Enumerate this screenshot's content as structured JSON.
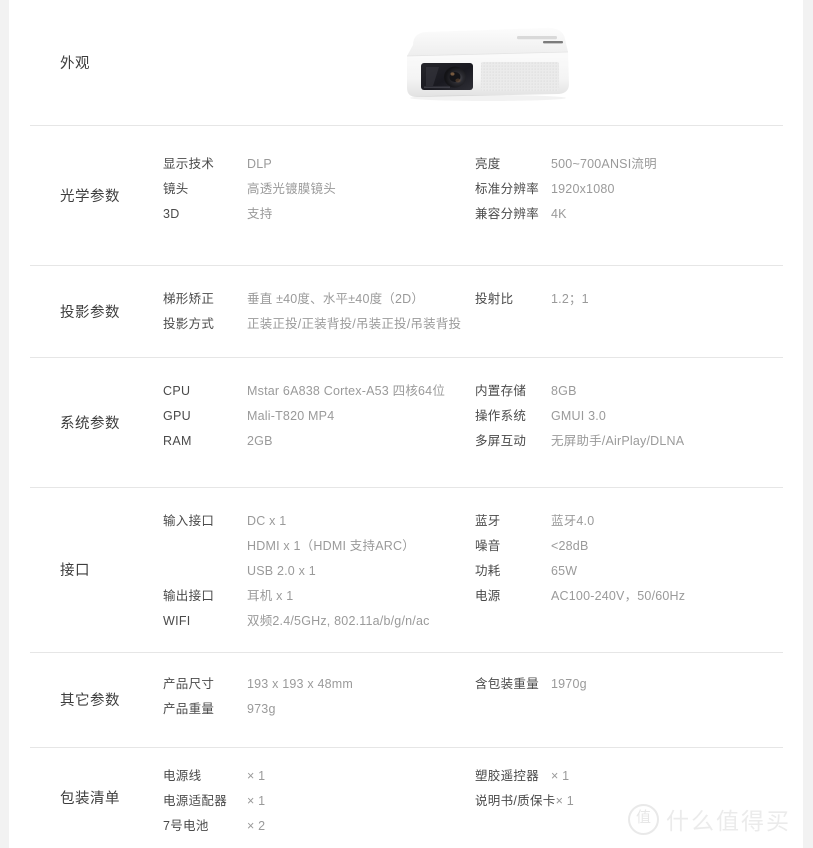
{
  "page": {
    "background": "#ffffff",
    "gutter_color": "#f2f2f2",
    "divider_color": "#e6e6e6",
    "title_color": "#3d3d3d",
    "key_color": "#4a4a4a",
    "value_color": "#9a9a9a"
  },
  "appearance": {
    "title": "外观",
    "image_alt": "白色投影仪正面图"
  },
  "sections": [
    {
      "id": "optics",
      "title": "光学参数",
      "left": [
        {
          "key": "显示技术",
          "value": "DLP"
        },
        {
          "key": "镜头",
          "value": "高透光镀膜镜头"
        },
        {
          "key": "3D",
          "value": "支持"
        }
      ],
      "right": [
        {
          "key": "亮度",
          "value": "500~700ANSI流明"
        },
        {
          "key": "标准分辨率",
          "value": "1920x1080"
        },
        {
          "key": "兼容分辨率",
          "value": "4K"
        }
      ]
    },
    {
      "id": "projection",
      "title": "投影参数",
      "left": [
        {
          "key": "梯形矫正",
          "value": "垂直 ±40度、水平±40度（2D）"
        },
        {
          "key": "投影方式",
          "value": "正装正投/正装背投/吊装正投/吊装背投"
        }
      ],
      "right": [
        {
          "key": "投射比",
          "value": "1.2；1"
        }
      ]
    },
    {
      "id": "system",
      "title": "系统参数",
      "left": [
        {
          "key": "CPU",
          "value": "Mstar 6A838 Cortex-A53 四核64位"
        },
        {
          "key": "GPU",
          "value": "Mali-T820 MP4"
        },
        {
          "key": "RAM",
          "value": "2GB"
        }
      ],
      "right": [
        {
          "key": "内置存储",
          "value": "8GB"
        },
        {
          "key": "操作系统",
          "value": "GMUI 3.0"
        },
        {
          "key": "多屏互动",
          "value": "无屏助手/AirPlay/DLNA"
        }
      ]
    },
    {
      "id": "ports",
      "title": "接口",
      "left": [
        {
          "key": "输入接口",
          "value": "DC x 1"
        },
        {
          "key": "",
          "value": "HDMI x 1（HDMI 支持ARC）"
        },
        {
          "key": "",
          "value": "USB 2.0 x 1"
        },
        {
          "key": "输出接口",
          "value": "耳机 x 1"
        },
        {
          "key": "WIFI",
          "value": "双频2.4/5GHz, 802.11a/b/g/n/ac"
        }
      ],
      "right": [
        {
          "key": "蓝牙",
          "value": "蓝牙4.0"
        },
        {
          "key": "噪音",
          "value": "<28dB"
        },
        {
          "key": "功耗",
          "value": "65W"
        },
        {
          "key": "电源",
          "value": "AC100-240V，50/60Hz"
        }
      ]
    },
    {
      "id": "other",
      "title": "其它参数",
      "left": [
        {
          "key": "产品尺寸",
          "value": "193 x 193 x 48mm"
        },
        {
          "key": "产品重量",
          "value": "973g"
        }
      ],
      "right": [
        {
          "key": "含包装重量",
          "value": "1970g"
        }
      ]
    },
    {
      "id": "package",
      "title": "包装清单",
      "left": [
        {
          "key": "电源线",
          "value": "× 1"
        },
        {
          "key": "电源适配器",
          "value": "× 1"
        },
        {
          "key": "7号电池",
          "value": "× 2"
        }
      ],
      "right": [
        {
          "key": "塑胶遥控器",
          "value": "× 1"
        },
        {
          "key": "说明书/质保卡",
          "value": "× 1"
        }
      ]
    }
  ],
  "watermark": {
    "badge": "值",
    "text": "什么值得买"
  }
}
